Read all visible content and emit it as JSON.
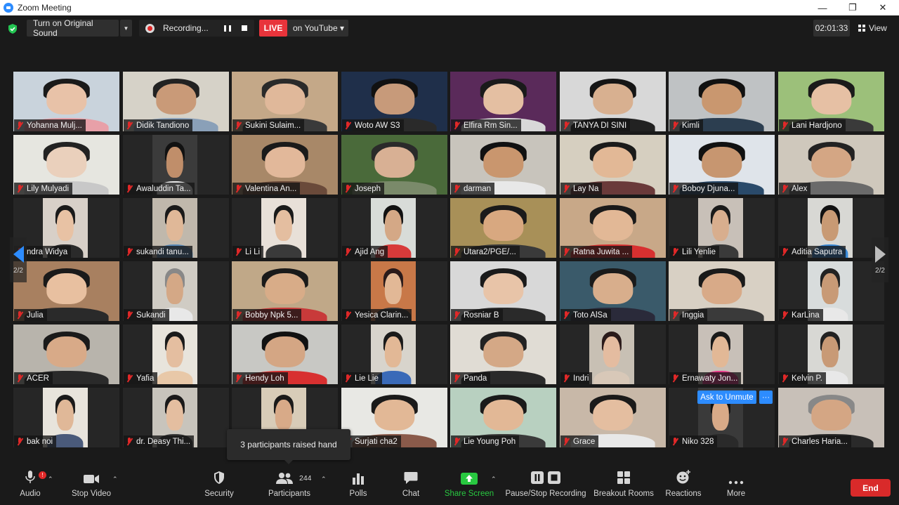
{
  "window": {
    "title": "Zoom Meeting",
    "minimize": "—",
    "restore": "❐",
    "close": "✕"
  },
  "top": {
    "sound_label": "Turn on Original Sound",
    "sound_caret": "▼",
    "recording_label": "Recording...",
    "live_label": "LIVE",
    "youtube_label": "on YouTube ▾",
    "timer": "02:01:33",
    "view_label": "View"
  },
  "colors": {
    "accent": "#2d8cff",
    "live": "#e8343b",
    "end": "#d92a2a",
    "share": "#28c840",
    "muted_mic": "#e02828"
  },
  "nav": {
    "page_left": "2/2",
    "page_right": "2/2"
  },
  "participants": [
    {
      "name": "Yohanna Mulj...",
      "bg": "#c9d3dc",
      "skin": "#e8c2a8",
      "shirt": "#e8a0a8",
      "hair": "#1a1a1a"
    },
    {
      "name": "Didik Tandiono",
      "bg": "#d6d2c8",
      "skin": "#c99a78",
      "shirt": "#8aa0b8",
      "hair": "#222"
    },
    {
      "name": "Sukini Sulaim...",
      "bg": "#c4a888",
      "skin": "#e0b89a",
      "shirt": "#3a3a3a",
      "hair": "#2a2a2a"
    },
    {
      "name": "Woto AW S3",
      "bg": "#1f2f4a",
      "skin": "#c79a7a",
      "shirt": "#2a2a2a",
      "hair": "#111"
    },
    {
      "name": "Elfira Rm Sin...",
      "bg": "#5a2a5a",
      "skin": "#e4bfa2",
      "shirt": "#d8d8d8",
      "hair": "#1a1a1a"
    },
    {
      "name": "TANYA DI SINI",
      "bg": "#d8d8d8",
      "skin": "#d8b090",
      "shirt": "#222",
      "hair": "#151515"
    },
    {
      "name": "Kimli",
      "bg": "#bfc2c4",
      "skin": "#c9976f",
      "shirt": "#2c3e50",
      "hair": "#111"
    },
    {
      "name": "Lani Hardjono",
      "bg": "#9cc07a",
      "skin": "#e6c0a4",
      "shirt": "#3a3a3a",
      "hair": "#1a1a1a"
    },
    {
      "name": "Lily Mulyadi",
      "bg": "#e6e6e0",
      "skin": "#ead0bc",
      "shirt": "#c8c8c8",
      "hair": "#222"
    },
    {
      "name": "Awaluddin Ta...",
      "bg": "#3b3b3b",
      "skin": "#c08e6a",
      "shirt": "#e8e8e8",
      "hair": "#111"
    },
    {
      "name": "Valentina An...",
      "bg": "#a88868",
      "skin": "#e2b89a",
      "shirt": "#6a4a3a",
      "hair": "#1a1a1a"
    },
    {
      "name": "Joseph",
      "bg": "#4a6a3a",
      "skin": "#d8b094",
      "shirt": "#7a8a6a",
      "hair": "#2a2a2a"
    },
    {
      "name": "darman",
      "bg": "#c8c4bc",
      "skin": "#c9966e",
      "shirt": "#e8e8e8",
      "hair": "#111"
    },
    {
      "name": "Lay Na",
      "bg": "#d6cfc0",
      "skin": "#e2b896",
      "shirt": "#6a3a3a",
      "hair": "#1a1a1a"
    },
    {
      "name": "Boboy Djuna...",
      "bg": "#dfe4ea",
      "skin": "#c79670",
      "shirt": "#2a4a6a",
      "hair": "#111"
    },
    {
      "name": "Alex",
      "bg": "#cfc8bc",
      "skin": "#d4a684",
      "shirt": "#6a6a6a",
      "hair": "#222"
    },
    {
      "name": "ndra Widya",
      "bg": "#d8d0c8",
      "skin": "#e8c2a4",
      "shirt": "#2a2a2a",
      "hair": "#1a1a1a"
    },
    {
      "name": "sukandi tanu...",
      "bg": "#c0b8ac",
      "skin": "#e0b898",
      "shirt": "#5a8ab8",
      "hair": "#1a1a1a"
    },
    {
      "name": "Li Li",
      "bg": "#e8e0d8",
      "skin": "#e4bea0",
      "shirt": "#3a3a3a",
      "hair": "#1a1a1a"
    },
    {
      "name": "Ajid Ang",
      "bg": "#d8dcd8",
      "skin": "#d4a886",
      "shirt": "#d83a3a",
      "hair": "#111"
    },
    {
      "name": "Utara2/PGE/...",
      "bg": "#a89058",
      "skin": "#d8a880",
      "shirt": "#3a3a3a",
      "hair": "#1a1a1a"
    },
    {
      "name": "Ratna Juwita ...",
      "bg": "#c8a888",
      "skin": "#e2b896",
      "shirt": "#d83030",
      "hair": "#1a1a1a"
    },
    {
      "name": "Lili Yenlie",
      "bg": "#c8c0b8",
      "skin": "#d8ae8e",
      "shirt": "#3a3a3a",
      "hair": "#1a1a1a"
    },
    {
      "name": "Aditia Saputra",
      "bg": "#d8d8d4",
      "skin": "#c89a74",
      "shirt": "#3a8ad8",
      "hair": "#111"
    },
    {
      "name": "Julia",
      "bg": "#a88060",
      "skin": "#e8c0a0",
      "shirt": "#2a2a2a",
      "hair": "#1a1a1a"
    },
    {
      "name": "Sukandi",
      "bg": "#d0ccc4",
      "skin": "#d4a886",
      "shirt": "#e8e8e8",
      "hair": "#888"
    },
    {
      "name": "Bobby Npk 5...",
      "bg": "#c0a888",
      "skin": "#d8ac88",
      "shirt": "#c83a3a",
      "hair": "#1a1a1a"
    },
    {
      "name": "Yesica Clarin...",
      "bg": "#c87848",
      "skin": "#e2b896",
      "shirt": "#3a3a3a",
      "hair": "#2a1a1a"
    },
    {
      "name": "Rosniar B",
      "bg": "#d8d8d8",
      "skin": "#e8c4a8",
      "shirt": "#2a2a2a",
      "hair": "#1a1a1a"
    },
    {
      "name": "Toto AlSa",
      "bg": "#3a5a6a",
      "skin": "#d8ae8c",
      "shirt": "#2a2a3a",
      "hair": "#1a1a1a"
    },
    {
      "name": "Inggia",
      "bg": "#d8d0c4",
      "skin": "#d8aa88",
      "shirt": "#3a3a3a",
      "hair": "#1a1a1a"
    },
    {
      "name": "KarLina",
      "bg": "#d8dcdc",
      "skin": "#c89a76",
      "shirt": "#e8e8e8",
      "hair": "#222"
    },
    {
      "name": "ACER",
      "bg": "#b8b4ac",
      "skin": "#d8aa88",
      "shirt": "#2a2a2a",
      "hair": "#1a1a1a"
    },
    {
      "name": "Yafia",
      "bg": "#e8e4dc",
      "skin": "#e4bea0",
      "shirt": "#e8c8a8",
      "hair": "#1a1a1a"
    },
    {
      "name": "Hendy Loh",
      "bg": "#c8c8c4",
      "skin": "#d4a684",
      "shirt": "#d83030",
      "hair": "#111"
    },
    {
      "name": "Lie Lie",
      "bg": "#d8d4cc",
      "skin": "#e2b896",
      "shirt": "#3a6ab8",
      "hair": "#1a1a1a"
    },
    {
      "name": "Panda",
      "bg": "#e0dcd4",
      "skin": "#d4a886",
      "shirt": "#2a2a2a",
      "hair": "#222"
    },
    {
      "name": "Indri",
      "bg": "#c8c0b4",
      "skin": "#e4bca0",
      "shirt": "#d8c8b8",
      "hair": "#2a1a1a"
    },
    {
      "name": "Ernawaty Jon...",
      "bg": "#c8c0b8",
      "skin": "#e2b896",
      "shirt": "#e83a8a",
      "hair": "#1a1a1a"
    },
    {
      "name": "Kelvin P.",
      "bg": "#d8d8d4",
      "skin": "#c89a76",
      "shirt": "#e8e8e8",
      "hair": "#222"
    },
    {
      "name": "bak noi",
      "bg": "#e8e4dc",
      "skin": "#e0b898",
      "shirt": "#4a5a7a",
      "hair": "#1a1a1a"
    },
    {
      "name": "dr. Deasy Thi...",
      "bg": "#c8c4bc",
      "skin": "#e4bea0",
      "shirt": "#3a3a3a",
      "hair": "#1a1a1a"
    },
    {
      "name": "",
      "bg": "#d8ccb8",
      "skin": "#d8aa88",
      "shirt": "#6a4a3a",
      "hair": "#1a1a1a"
    },
    {
      "name": "Surjati cha2",
      "bg": "#e8e8e4",
      "skin": "#e2b896",
      "shirt": "#8a5a4a",
      "hair": "#1a1a1a"
    },
    {
      "name": "Lie Young Poh",
      "bg": "#b8d0c0",
      "skin": "#e2b896",
      "shirt": "#3a3a3a",
      "hair": "#1a1a1a"
    },
    {
      "name": "Grace",
      "bg": "#c8b8a8",
      "skin": "#e4bea0",
      "shirt": "#e8e8e8",
      "hair": "#1a1a1a"
    },
    {
      "name": "Niko 328",
      "bg": "#3a3a3a",
      "skin": "#d8aa88",
      "shirt": "#2a2a2a",
      "hair": "#111"
    },
    {
      "name": "Charles Haria...",
      "bg": "#c8c0b8",
      "skin": "#d4a684",
      "shirt": "#2a2a2a",
      "hair": "#888"
    }
  ],
  "tile_overlay": {
    "ask_to_unmute": "Ask to Unmute",
    "more": "···"
  },
  "tooltip": "3 participants raised hand",
  "toolbar": {
    "audio": "Audio",
    "audio_badge": "!",
    "stop_video": "Stop Video",
    "security": "Security",
    "participants": "Participants",
    "participants_count": "244",
    "polls": "Polls",
    "chat": "Chat",
    "share_screen": "Share Screen",
    "pause_stop_recording": "Pause/Stop Recording",
    "breakout_rooms": "Breakout Rooms",
    "reactions": "Reactions",
    "more": "More",
    "end": "End"
  }
}
